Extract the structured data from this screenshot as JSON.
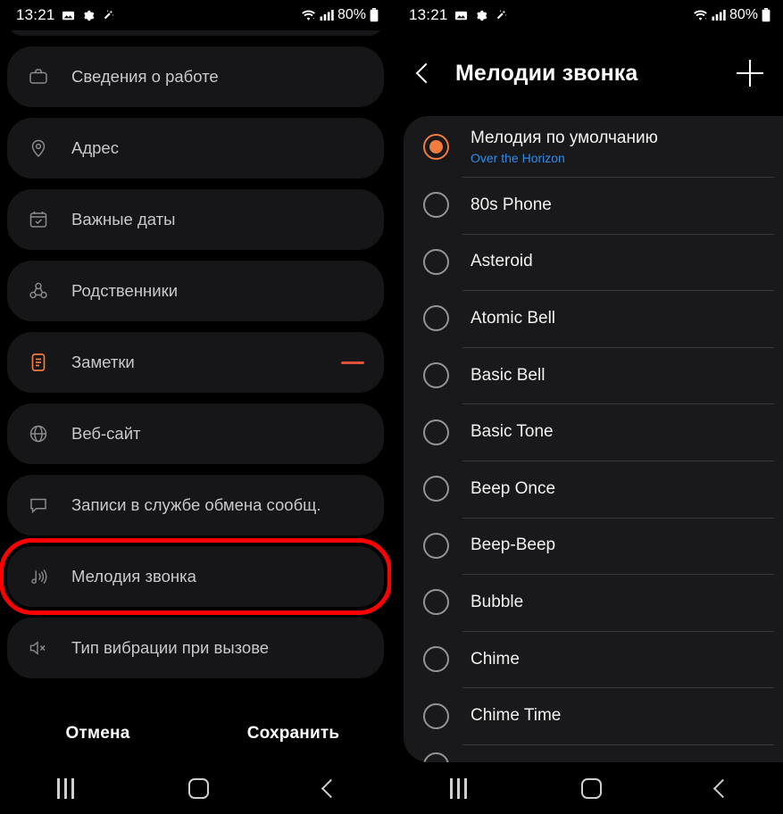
{
  "status_bar": {
    "time": "13:21",
    "left_icons": [
      "image-icon",
      "gear-icon",
      "magic-wand-icon"
    ],
    "wifi": "wifi-icon",
    "signal": "signal-icon",
    "battery_text": "80%",
    "battery": "battery-icon"
  },
  "left_panel": {
    "partial_card_top": "",
    "items": [
      {
        "label": "Сведения о работе",
        "icon": "briefcase-icon",
        "accent": false,
        "trailing": "none"
      },
      {
        "label": "Адрес",
        "icon": "location-pin-icon",
        "accent": false,
        "trailing": "none"
      },
      {
        "label": "Важные даты",
        "icon": "calendar-check-icon",
        "accent": false,
        "trailing": "none"
      },
      {
        "label": "Родственники",
        "icon": "relationship-icon",
        "accent": false,
        "trailing": "none"
      },
      {
        "label": "Заметки",
        "icon": "note-icon",
        "accent": true,
        "trailing": "minus"
      },
      {
        "label": "Веб-сайт",
        "icon": "globe-icon",
        "accent": false,
        "trailing": "none"
      },
      {
        "label": "Записи в службе обмена сообщ.",
        "icon": "chat-bubble-icon",
        "accent": false,
        "trailing": "none"
      },
      {
        "label": "Мелодия звонка",
        "icon": "ringtone-icon",
        "accent": false,
        "trailing": "none"
      },
      {
        "label": "Тип вибрации при вызове",
        "icon": "vibration-mute-icon",
        "accent": false,
        "trailing": "none"
      }
    ],
    "highlighted_item_label": "Мелодия звонка",
    "highlight_color": "#fe0000",
    "cancel_label": "Отмена",
    "save_label": "Сохранить"
  },
  "right_panel": {
    "title": "Мелодии звонка",
    "back_icon": "chevron-left-icon",
    "add_icon": "plus-icon",
    "accent_color": "#f07b3f",
    "subtitle_color": "#2e8bea",
    "tones": [
      {
        "name": "Мелодия по умолчанию",
        "subtitle": "Over the Horizon",
        "selected": true
      },
      {
        "name": "80s Phone",
        "subtitle": "",
        "selected": false
      },
      {
        "name": "Asteroid",
        "subtitle": "",
        "selected": false
      },
      {
        "name": "Atomic Bell",
        "subtitle": "",
        "selected": false
      },
      {
        "name": "Basic Bell",
        "subtitle": "",
        "selected": false
      },
      {
        "name": "Basic Tone",
        "subtitle": "",
        "selected": false
      },
      {
        "name": "Beep Once",
        "subtitle": "",
        "selected": false
      },
      {
        "name": "Beep-Beep",
        "subtitle": "",
        "selected": false
      },
      {
        "name": "Bubble",
        "subtitle": "",
        "selected": false
      },
      {
        "name": "Chime",
        "subtitle": "",
        "selected": false
      },
      {
        "name": "Chime Time",
        "subtitle": "",
        "selected": false
      }
    ]
  },
  "nav_bar": {
    "recents": "recents-icon",
    "home": "home-icon",
    "back": "back-icon"
  }
}
